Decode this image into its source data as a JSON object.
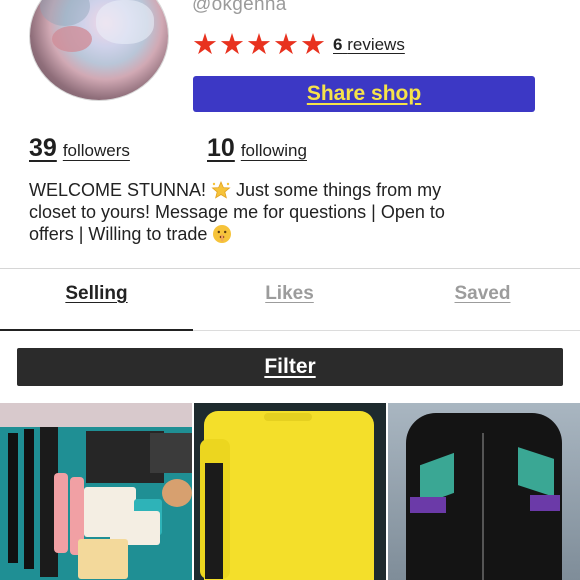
{
  "profile": {
    "username": "@okgenna",
    "rating_stars": 5,
    "reviews_count": "6",
    "reviews_label": "reviews",
    "share_label": "Share shop",
    "followers_count": "39",
    "followers_label": "followers",
    "following_count": "10",
    "following_label": "following",
    "bio_line1": "WELCOME STUNNA!",
    "bio_line1b": "Just some things from my",
    "bio_line2": "closet to yours! Message me for questions | Open to",
    "bio_line3": "offers | Willing to trade"
  },
  "tabs": [
    {
      "label": "Selling",
      "active": true
    },
    {
      "label": "Likes",
      "active": false
    },
    {
      "label": "Saved",
      "active": false
    }
  ],
  "filter_label": "Filter",
  "colors": {
    "accent_blue": "#3c38c5",
    "share_text_yellow": "#f6e34a",
    "star_red": "#e8321f",
    "filter_bg": "#2b2b2b"
  },
  "listings": [
    {
      "name": "makeup-bundle-thumb"
    },
    {
      "name": "yellow-sweater-thumb"
    },
    {
      "name": "windbreaker-jacket-thumb"
    }
  ]
}
